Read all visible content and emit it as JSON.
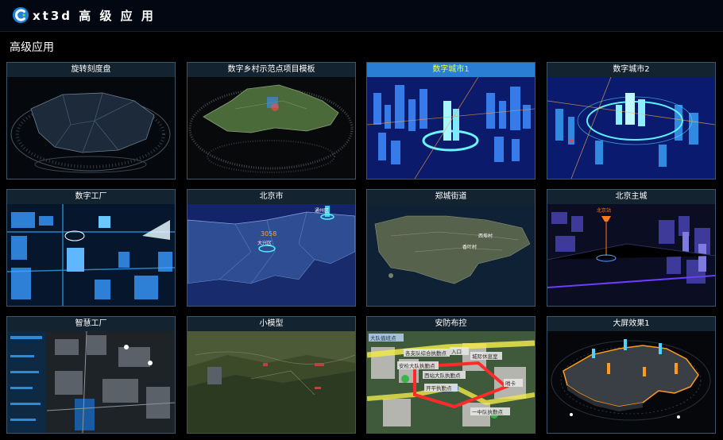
{
  "header": {
    "app_title": "xt3d 高 级 应 用",
    "logo_icon": "cesium-logo-icon"
  },
  "section": {
    "title": "高级应用"
  },
  "colors": {
    "background": "#000000",
    "card_border": "#3a566a",
    "card_title_bg": "#13232f",
    "active_title_bg": "#2a7fd4",
    "active_title_text": "#e9ff42"
  },
  "cards": [
    {
      "title": "旋转刻度盘",
      "thumb": "rotating-dial-map"
    },
    {
      "title": "数字乡村示范点项目模板",
      "thumb": "digital-village-terrain"
    },
    {
      "title": "数字城市1",
      "thumb": "digital-city-blue",
      "active": true
    },
    {
      "title": "数字城市2",
      "thumb": "digital-city-ring"
    },
    {
      "title": "数字工厂",
      "thumb": "digital-factory"
    },
    {
      "title": "北京市",
      "thumb": "beijing-map",
      "labels": [
        "3058",
        "大兴区",
        "通州区"
      ]
    },
    {
      "title": "郑城街道",
      "thumb": "street-satellite",
      "labels": [
        "西埠村",
        "香叶村"
      ]
    },
    {
      "title": "北京主城",
      "thumb": "beijing-main-city",
      "labels": [
        "北京站"
      ]
    },
    {
      "title": "智慧工厂",
      "thumb": "smart-factory"
    },
    {
      "title": "小模型",
      "thumb": "small-model-terrain"
    },
    {
      "title": "安防布控",
      "thumb": "security-deploy",
      "labels": [
        "大队值班点",
        "各支队综合执勤点",
        "安检大队执勤点",
        "西站大队执勤点",
        "开平执勤点",
        "入口",
        "城际休息室",
        "哨卡",
        "一中队执勤点"
      ]
    },
    {
      "title": "大屏效果1",
      "thumb": "big-screen-map"
    }
  ]
}
